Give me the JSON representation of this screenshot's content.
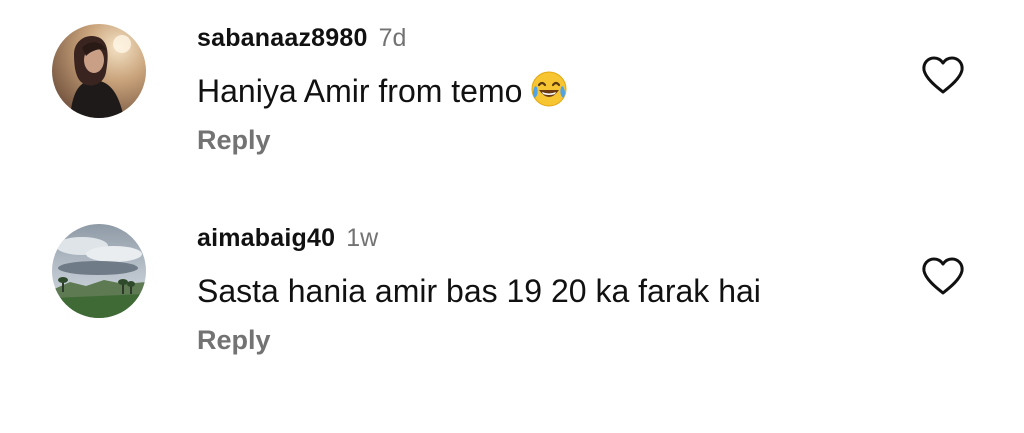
{
  "comments": [
    {
      "username": "sabanaaz8980",
      "time": "7d",
      "text": "Haniya Amir from temo",
      "emoji": "face-with-tears-of-joy",
      "reply_label": "Reply",
      "liked": false
    },
    {
      "username": "aimabaig40",
      "time": "1w",
      "text": "Sasta hania amir bas 19 20 ka farak hai",
      "reply_label": "Reply",
      "liked": false
    }
  ],
  "icons": {
    "like": "heart-outline-icon"
  },
  "colors": {
    "text": "#111111",
    "secondary": "#737373",
    "background": "#ffffff"
  }
}
